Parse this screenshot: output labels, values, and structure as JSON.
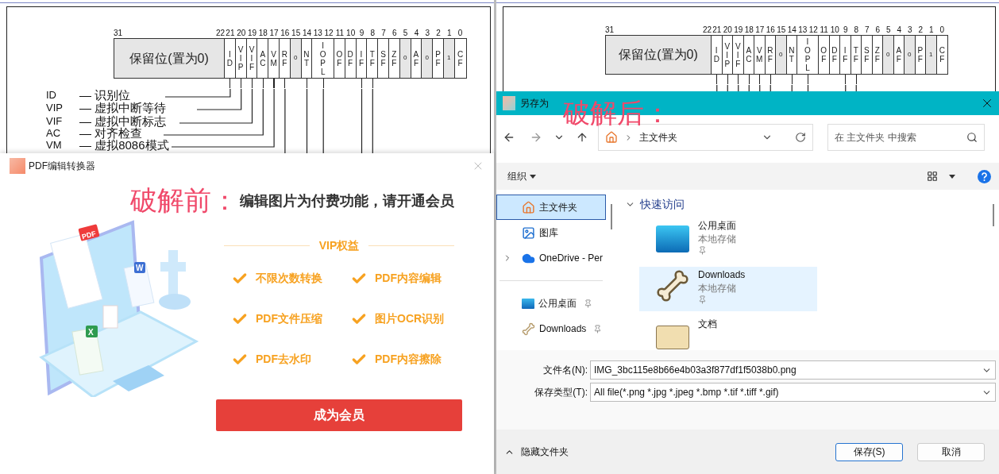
{
  "left_panel": {
    "document": {
      "register": {
        "reserved": {
          "label": "保留位(置为0)",
          "bits": [
            "31",
            "22"
          ]
        },
        "fields": [
          {
            "label": "ID",
            "bits": [
              "21"
            ],
            "shaded": false,
            "leader": true
          },
          {
            "label": "VIP",
            "bits": [
              "20"
            ],
            "shaded": false,
            "leader": true
          },
          {
            "label": "VIF",
            "bits": [
              "19"
            ],
            "shaded": false,
            "leader": true
          },
          {
            "label": "AC",
            "bits": [
              "18"
            ],
            "shaded": false,
            "leader": true
          },
          {
            "label": "VM",
            "bits": [
              "17"
            ],
            "shaded": false,
            "leader": true
          },
          {
            "label": "RF",
            "bits": [
              "16"
            ],
            "shaded": false,
            "leader": true
          },
          {
            "label": "0",
            "bits": [
              "15"
            ],
            "shaded": true,
            "leader": false
          },
          {
            "label": "NT",
            "bits": [
              "14"
            ],
            "shaded": false,
            "leader": true
          },
          {
            "label": "IOPL",
            "bits": [
              "13",
              "12"
            ],
            "shaded": false,
            "leader": true
          },
          {
            "label": "OF",
            "bits": [
              "11"
            ],
            "shaded": false,
            "leader": false
          },
          {
            "label": "DF",
            "bits": [
              "10"
            ],
            "shaded": false,
            "leader": false
          },
          {
            "label": "IF",
            "bits": [
              "9"
            ],
            "shaded": false,
            "leader": true
          },
          {
            "label": "TF",
            "bits": [
              "8"
            ],
            "shaded": false,
            "leader": true
          },
          {
            "label": "SF",
            "bits": [
              "7"
            ],
            "shaded": false,
            "leader": false
          },
          {
            "label": "ZF",
            "bits": [
              "6"
            ],
            "shaded": false,
            "leader": false
          },
          {
            "label": "0",
            "bits": [
              "5"
            ],
            "shaded": true,
            "leader": false
          },
          {
            "label": "AF",
            "bits": [
              "4"
            ],
            "shaded": false,
            "leader": false
          },
          {
            "label": "0",
            "bits": [
              "3"
            ],
            "shaded": true,
            "leader": false
          },
          {
            "label": "PF",
            "bits": [
              "2"
            ],
            "shaded": false,
            "leader": false
          },
          {
            "label": "1",
            "bits": [
              "1"
            ],
            "shaded": true,
            "leader": false
          },
          {
            "label": "CF",
            "bits": [
              "0"
            ],
            "shaded": false,
            "leader": false
          }
        ]
      },
      "legend": [
        {
          "abbr": "ID",
          "meaning": "— 识别位"
        },
        {
          "abbr": "VIP",
          "meaning": "— 虚拟中断等待"
        },
        {
          "abbr": "VIF",
          "meaning": "— 虚拟中断标志"
        },
        {
          "abbr": "AC",
          "meaning": "— 对齐检查"
        },
        {
          "abbr": "VM",
          "meaning": "— 虚拟8086模式"
        }
      ]
    },
    "dialog": {
      "title": "PDF编辑转换器",
      "heading_tag": "破解前：",
      "heading": "编辑图片为付费功能，请开通会员",
      "illustration_labels": [
        "PDF",
        "W",
        "X"
      ],
      "benefits_title": "VIP权益",
      "benefits": [
        "不限次数转换",
        "PDF内容编辑",
        "PDF文件压缩",
        "图片OCR识别",
        "PDF去水印",
        "PDF内容擦除"
      ],
      "button": "成为会员"
    }
  },
  "right_panel": {
    "document": {
      "register": {
        "reserved": {
          "label": "保留位(置为0)",
          "bits": [
            "31",
            "22"
          ]
        },
        "fields": [
          {
            "label": "ID",
            "bits": [
              "21"
            ],
            "shaded": false,
            "leader": true
          },
          {
            "label": "VIP",
            "bits": [
              "20"
            ],
            "shaded": false,
            "leader": true
          },
          {
            "label": "VIF",
            "bits": [
              "19"
            ],
            "shaded": false,
            "leader": true
          },
          {
            "label": "AC",
            "bits": [
              "18"
            ],
            "shaded": false,
            "leader": true
          },
          {
            "label": "VM",
            "bits": [
              "17"
            ],
            "shaded": false,
            "leader": true
          },
          {
            "label": "RF",
            "bits": [
              "16"
            ],
            "shaded": false,
            "leader": true
          },
          {
            "label": "0",
            "bits": [
              "15"
            ],
            "shaded": true,
            "leader": false
          },
          {
            "label": "NT",
            "bits": [
              "14"
            ],
            "shaded": false,
            "leader": true
          },
          {
            "label": "IOPL",
            "bits": [
              "13",
              "12"
            ],
            "shaded": false,
            "leader": true
          },
          {
            "label": "OF",
            "bits": [
              "11"
            ],
            "shaded": false,
            "leader": false
          },
          {
            "label": "DF",
            "bits": [
              "10"
            ],
            "shaded": false,
            "leader": false
          },
          {
            "label": "IF",
            "bits": [
              "9"
            ],
            "shaded": false,
            "leader": true
          },
          {
            "label": "TF",
            "bits": [
              "8"
            ],
            "shaded": false,
            "leader": true
          },
          {
            "label": "SF",
            "bits": [
              "7"
            ],
            "shaded": false,
            "leader": false
          },
          {
            "label": "ZF",
            "bits": [
              "6"
            ],
            "shaded": false,
            "leader": false
          },
          {
            "label": "0",
            "bits": [
              "5"
            ],
            "shaded": true,
            "leader": false
          },
          {
            "label": "AF",
            "bits": [
              "4"
            ],
            "shaded": false,
            "leader": false
          },
          {
            "label": "0",
            "bits": [
              "3"
            ],
            "shaded": true,
            "leader": false
          },
          {
            "label": "PF",
            "bits": [
              "2"
            ],
            "shaded": false,
            "leader": false
          },
          {
            "label": "1",
            "bits": [
              "1"
            ],
            "shaded": true,
            "leader": false
          },
          {
            "label": "CF",
            "bits": [
              "0"
            ],
            "shaded": false,
            "leader": false
          }
        ]
      }
    },
    "save_dialog": {
      "title": "另存为",
      "overlay_tag": "破解后：",
      "address": "主文件夹",
      "search": {
        "placeholder": "在 主文件夹 中搜索"
      },
      "organize": "组织",
      "nav_groups": [
        [
          {
            "label": "主文件夹",
            "kind": "home",
            "selected": true,
            "pinned": false
          },
          {
            "label": "图库",
            "kind": "gallery",
            "selected": false,
            "pinned": false
          },
          {
            "label": "OneDrive - Per",
            "kind": "cloud",
            "selected": false,
            "pinned": false,
            "expanded": false
          }
        ],
        [
          {
            "label": "公用桌面",
            "kind": "desktop",
            "selected": false,
            "pinned": true
          },
          {
            "label": "Downloads",
            "kind": "downloads",
            "selected": false,
            "pinned": true
          }
        ]
      ],
      "section": {
        "title": "快速访问",
        "expanded": true
      },
      "items": [
        {
          "name": "公用桌面",
          "subtitle": "本地存储",
          "kind": "desktop",
          "selected": false,
          "pinned": true
        },
        {
          "name": "Downloads",
          "subtitle": "本地存储",
          "kind": "downloads",
          "selected": true,
          "pinned": true
        },
        {
          "name": "文档",
          "kind": "documents",
          "selected": false,
          "pinned": false
        }
      ],
      "file_name": {
        "label": "文件名(N):",
        "value": "IMG_3bc115e8b66e4b03a3f877df1f5038b0.png"
      },
      "file_type": {
        "label": "保存类型(T):",
        "value": "All file(*.png *.jpg *.jpeg *.bmp *.tif *.tiff *.gif)"
      },
      "hide_folders": "隐藏文件夹",
      "buttons": [
        {
          "label": "保存(S)",
          "primary": true
        },
        {
          "label": "取消",
          "primary": false
        }
      ]
    }
  }
}
